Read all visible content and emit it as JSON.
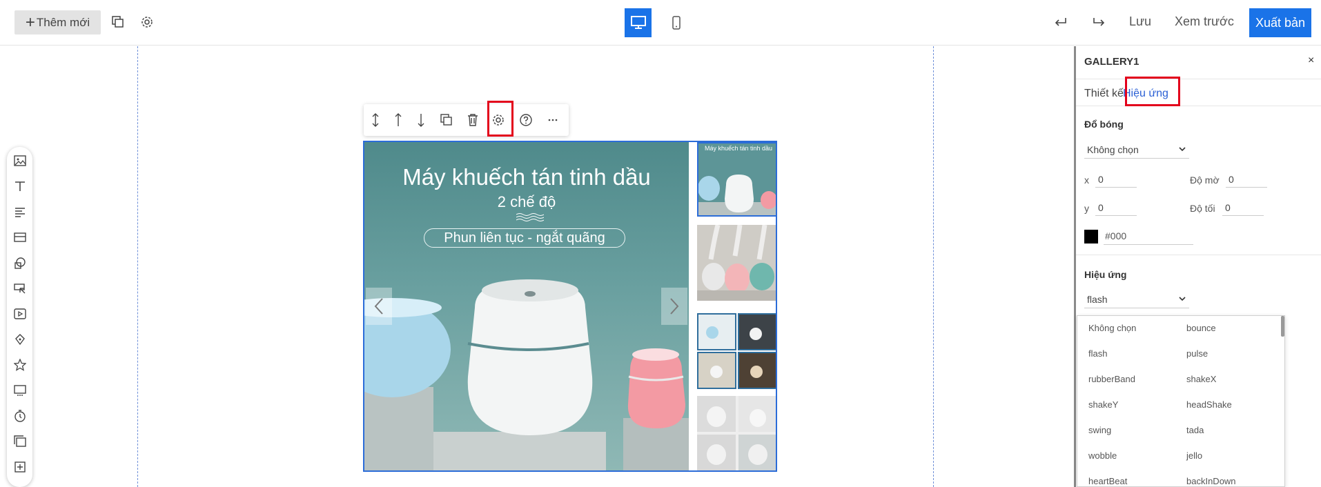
{
  "toolbar": {
    "add_new_label": "Thêm mới",
    "save_label": "Lưu",
    "preview_label": "Xem trước",
    "publish_label": "Xuất bản"
  },
  "gallery": {
    "main_title": "Máy khuếch tán tinh dầu",
    "main_subtitle": "2 chế độ",
    "main_pill": "Phun liên tục - ngắt quãng",
    "thumb_title": "Máy khuếch tán tinh dầu"
  },
  "panel": {
    "title": "GALLERY1",
    "close": "×",
    "tabs": {
      "design": "Thiết kế",
      "effect": "Hiệu ứng"
    },
    "shadow": {
      "label": "Đổ bóng",
      "select_value": "Không chọn",
      "x_label": "x",
      "x_value": "0",
      "blur_label": "Độ mờ",
      "blur_value": "0",
      "y_label": "y",
      "y_value": "0",
      "dark_label": "Độ tối",
      "dark_value": "0",
      "color": "#000"
    },
    "effect": {
      "label": "Hiệu ứng",
      "select_value": "flash"
    }
  },
  "dropdown": {
    "left": [
      "Không chọn",
      "flash",
      "rubberBand",
      "shakeY",
      "swing",
      "wobble",
      "heartBeat"
    ],
    "right": [
      "bounce",
      "pulse",
      "shakeX",
      "headShake",
      "tada",
      "jello",
      "backInDown"
    ]
  },
  "colors": {
    "accent": "#1a73e8",
    "highlight": "#e3001b",
    "selection": "#2b6cd8",
    "active_tab": "#2a5fd4"
  }
}
